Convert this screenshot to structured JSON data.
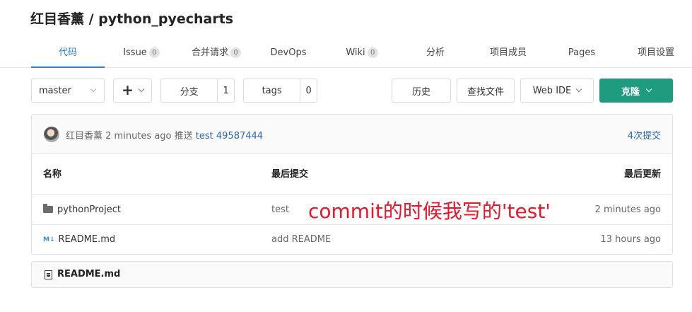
{
  "header": {
    "title": "红目香薰 / python_pyecharts"
  },
  "tabs": [
    {
      "label": "代码"
    },
    {
      "label": "Issue",
      "count": "0"
    },
    {
      "label": "合并请求",
      "count": "0"
    },
    {
      "label": "DevOps"
    },
    {
      "label": "Wiki",
      "count": "0"
    },
    {
      "label": "分析"
    },
    {
      "label": "项目成员"
    },
    {
      "label": "Pages"
    },
    {
      "label": "项目设置"
    }
  ],
  "toolbar": {
    "branch": "master",
    "plus": "+",
    "branches_label": "分支",
    "branches_count": "1",
    "tags_label": "tags",
    "tags_count": "0",
    "history": "历史",
    "find_file": "查找文件",
    "web_ide": "Web IDE",
    "clone": "克隆"
  },
  "commit": {
    "author": "红目香薰",
    "time": "2 minutes ago",
    "action": "推送",
    "message": "test",
    "hash": "49587444",
    "commits_link": "4次提交"
  },
  "table": {
    "headers": [
      "名称",
      "最后提交",
      "最后更新"
    ],
    "rows": [
      {
        "icon": "folder-icon",
        "name": "pythonProject",
        "commit": "test",
        "updated": "2 minutes ago"
      },
      {
        "icon": "markdown-icon",
        "name": "README.md",
        "commit": "add README",
        "updated": "13 hours ago"
      }
    ]
  },
  "annotation": "commit的时候我写的'test'",
  "readme": {
    "title": "README.md"
  },
  "colors": {
    "accent": "#2a80d2",
    "clone": "#1f9c7f",
    "annotation": "#f0142a"
  }
}
